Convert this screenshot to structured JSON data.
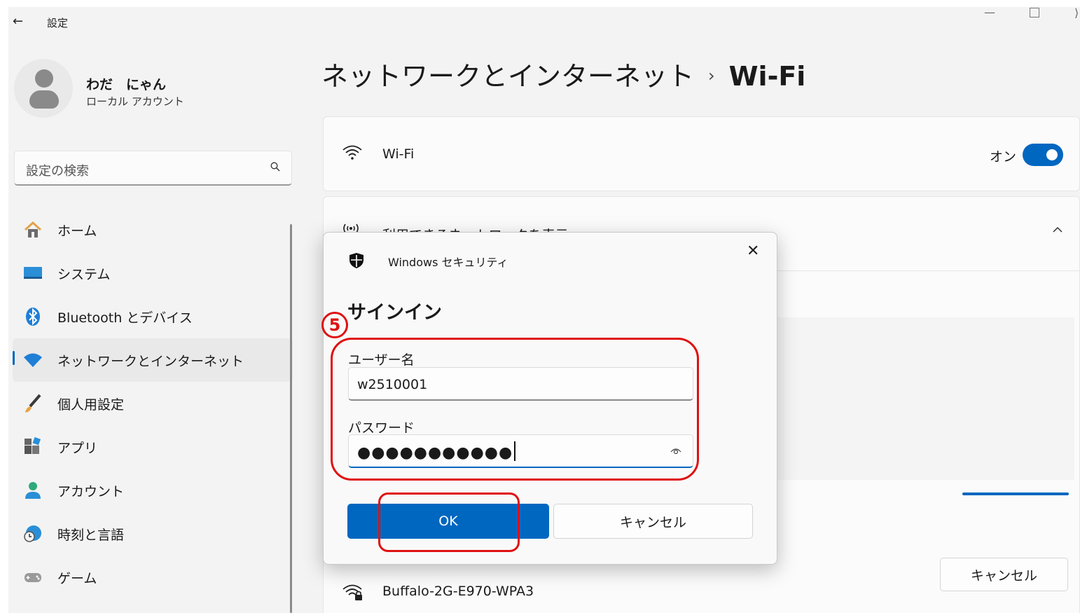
{
  "window": {
    "title": "設定",
    "back_icon": "←",
    "minimize": "—",
    "close_partial": "⟩"
  },
  "profile": {
    "name": "わだ　にゃん",
    "account_type": "ローカル アカウント"
  },
  "search": {
    "placeholder": "設定の検索"
  },
  "sidebar": {
    "items": [
      {
        "label": "ホーム",
        "icon": "home-icon",
        "active": false
      },
      {
        "label": "システム",
        "icon": "system-icon",
        "active": false
      },
      {
        "label": "Bluetooth とデバイス",
        "icon": "bluetooth-icon",
        "active": false
      },
      {
        "label": "ネットワークとインターネット",
        "icon": "network-icon",
        "active": true
      },
      {
        "label": "個人用設定",
        "icon": "brush-icon",
        "active": false
      },
      {
        "label": "アプリ",
        "icon": "apps-icon",
        "active": false
      },
      {
        "label": "アカウント",
        "icon": "account-icon",
        "active": false
      },
      {
        "label": "時刻と言語",
        "icon": "time-language-icon",
        "active": false
      },
      {
        "label": "ゲーム",
        "icon": "game-icon",
        "active": false
      }
    ]
  },
  "breadcrumb": {
    "parent": "ネットワークとインターネット",
    "separator": "›",
    "current": "Wi-Fi"
  },
  "wifi": {
    "label": "Wi-Fi",
    "toggle_label": "オン",
    "toggle_on": true
  },
  "available": {
    "label": "利用できるネットワークを表示",
    "expanded": true,
    "cancel_label": "キャンセル",
    "network_name": "Buffalo-2G-E970-WPA3"
  },
  "dialog": {
    "title": "Windows セキュリティ",
    "close": "✕",
    "heading": "サインイン",
    "username_label": "ユーザー名",
    "username_value": "w2510001",
    "password_label": "パスワード",
    "password_masked": "●●●●●●●●●●●",
    "ok_label": "OK",
    "cancel_label": "キャンセル"
  },
  "annotation": {
    "step": "5"
  },
  "colors": {
    "accent": "#0067c0",
    "highlight": "#e01010",
    "background": "#f3f3f3"
  }
}
